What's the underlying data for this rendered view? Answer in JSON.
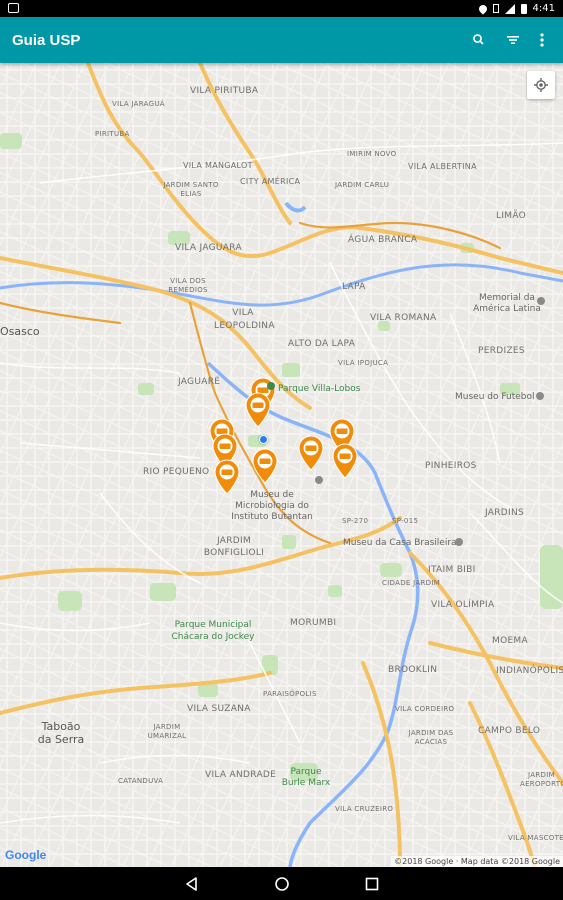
{
  "status_bar": {
    "time": "4:41"
  },
  "app_bar": {
    "title": "Guia USP",
    "actions": [
      "search-icon",
      "filter-icon",
      "more-vert-icon"
    ]
  },
  "map": {
    "labels": [
      {
        "text": "VILA PIRITUBA"
      },
      {
        "text": "VILA JARAGUÁ"
      },
      {
        "text": "PIRITUBA"
      },
      {
        "text": "VILA MANGALOT"
      },
      {
        "text": "JARDIM SANTO ELIAS"
      },
      {
        "text": "CITY AMÉRICA"
      },
      {
        "text": "IMIRIM NOVO"
      },
      {
        "text": "JARDIM CARLU"
      },
      {
        "text": "VILA ALBERTINA"
      },
      {
        "text": "VILA JAGUARA"
      },
      {
        "text": "ÁGUA BRANCA"
      },
      {
        "text": "LIMÃO"
      },
      {
        "text": "VILA DOS REMÉDIOS"
      },
      {
        "text": "Osasco"
      },
      {
        "text": "VILA LEOPOLDINA"
      },
      {
        "text": "LAPA"
      },
      {
        "text": "Memorial da América Latina"
      },
      {
        "text": "VILA ROMANA"
      },
      {
        "text": "ALTO DA LAPA"
      },
      {
        "text": "PERDIZES"
      },
      {
        "text": "VILA IPOJUCA"
      },
      {
        "text": "JAGUARÉ"
      },
      {
        "text": "Parque Villa-Lobos"
      },
      {
        "text": "Museu do Futebol"
      },
      {
        "text": "PINHEIROS"
      },
      {
        "text": "RIO PEQUENO"
      },
      {
        "text": "Museu de Microbiologia do Instituto Butantan"
      },
      {
        "text": "JARDINS"
      },
      {
        "text": "JARDIM BONFIGLIOLI"
      },
      {
        "text": "Museu da Casa Brasileira"
      },
      {
        "text": "ITAIM BIBI"
      },
      {
        "text": "VILA OLÍMPIA"
      },
      {
        "text": "Parque Municipal Chácara do Jockey"
      },
      {
        "text": "MORUMBI"
      },
      {
        "text": "MOEMA"
      },
      {
        "text": "BROOKLIN"
      },
      {
        "text": "INDIANÓPOLIS"
      },
      {
        "text": "PARAISÓPOLIS"
      },
      {
        "text": "Taboão da Serra"
      },
      {
        "text": "JARDIM UMARIZAL"
      },
      {
        "text": "VILA SUZANA"
      },
      {
        "text": "VILA CORDEIRO"
      },
      {
        "text": "CAMPO BELO"
      },
      {
        "text": "JARDIM DAS ACÁCIAS"
      },
      {
        "text": "VILA ANDRADE"
      },
      {
        "text": "Parque Burle Marx"
      },
      {
        "text": "CATANDUVA"
      },
      {
        "text": "VILA CRUZEIRO"
      },
      {
        "text": "JARDIM AEROPORTO"
      },
      {
        "text": "VILA MASCOTE"
      },
      {
        "text": "CIDADE JARDIM"
      },
      {
        "text": "SP-270"
      },
      {
        "text": "SP-015"
      }
    ],
    "pins": [
      {
        "label": "marker-1"
      },
      {
        "label": "marker-2"
      },
      {
        "label": "marker-3"
      },
      {
        "label": "marker-4"
      },
      {
        "label": "marker-5"
      },
      {
        "label": "marker-6"
      },
      {
        "label": "marker-7"
      },
      {
        "label": "marker-8"
      },
      {
        "label": "marker-9"
      },
      {
        "label": "marker-10"
      }
    ],
    "pin_color": "#f08c0a",
    "water_color": "#8ab4f8",
    "highway_color": "#f4c262",
    "park_color": "#c8e5b9",
    "google_logo": "Google",
    "copyright": "©2018 Google · Map data ©2018 Google"
  },
  "accent_color": "#0097a7"
}
